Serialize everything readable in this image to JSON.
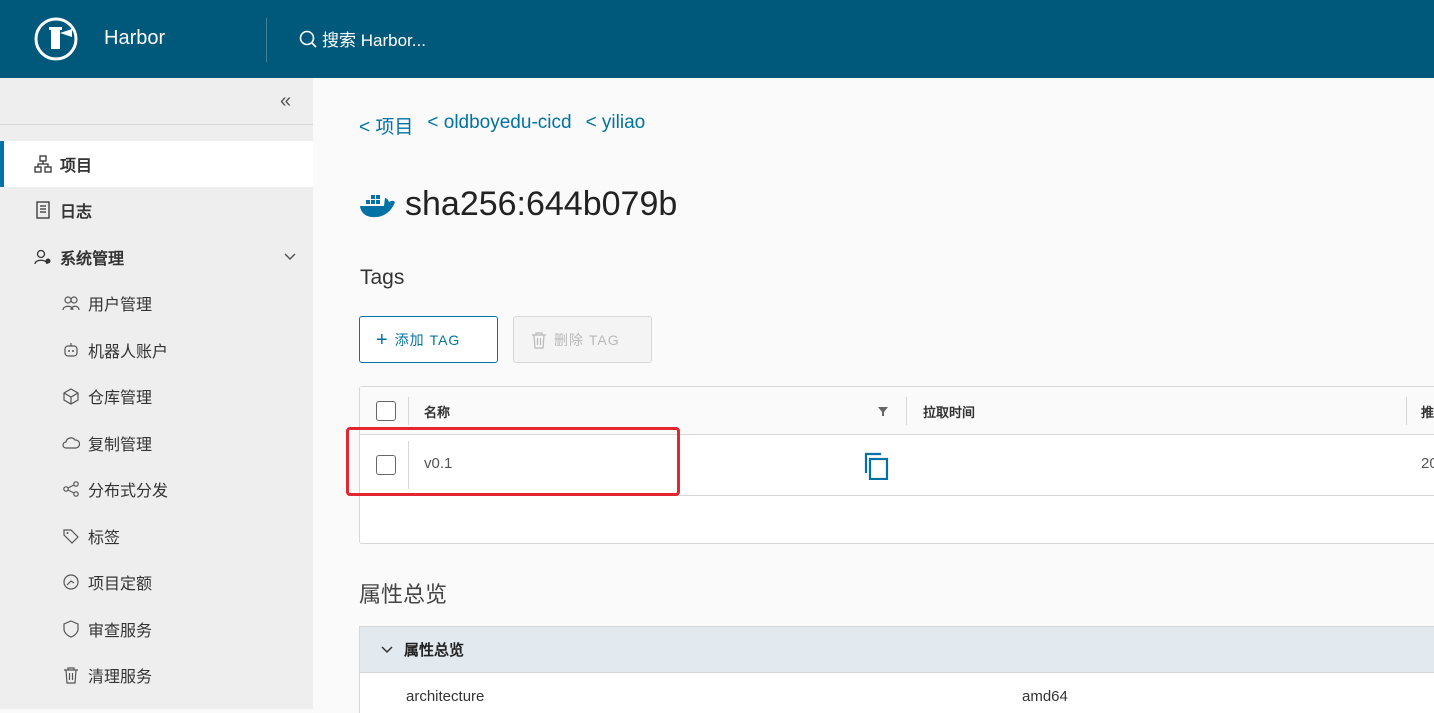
{
  "header": {
    "brand": "Harbor",
    "search_placeholder": "搜索 Harbor..."
  },
  "sidebar": {
    "items": [
      {
        "label": "项目",
        "icon": "project-icon"
      },
      {
        "label": "日志",
        "icon": "log-icon"
      },
      {
        "label": "系统管理",
        "icon": "admin-icon"
      },
      {
        "label": "用户管理",
        "icon": "users-icon"
      },
      {
        "label": "机器人账户",
        "icon": "robot-icon"
      },
      {
        "label": "仓库管理",
        "icon": "registry-icon"
      },
      {
        "label": "复制管理",
        "icon": "replication-icon"
      },
      {
        "label": "分布式分发",
        "icon": "distribution-icon"
      },
      {
        "label": "标签",
        "icon": "label-icon"
      },
      {
        "label": "项目定额",
        "icon": "quota-icon"
      },
      {
        "label": "审查服务",
        "icon": "scanner-icon"
      },
      {
        "label": "清理服务",
        "icon": "gc-icon"
      }
    ]
  },
  "breadcrumb": [
    "< 项目",
    "< oldboyedu-cicd",
    "< yiliao"
  ],
  "page_title": "sha256:644b079b",
  "tags_section": {
    "heading": "Tags",
    "add_label": "添加 TAG",
    "delete_label": "删除 TAG",
    "columns": [
      "名称",
      "拉取时间",
      "推"
    ],
    "rows": [
      {
        "name": "v0.1",
        "push_time": "20"
      }
    ]
  },
  "attributes": {
    "heading": "属性总览",
    "panel_title": "属性总览",
    "items": [
      {
        "key": "architecture",
        "value": "amd64"
      }
    ]
  },
  "colors": {
    "header_bg": "#00587a",
    "link": "#0072a3",
    "highlight": "#e3262f"
  }
}
